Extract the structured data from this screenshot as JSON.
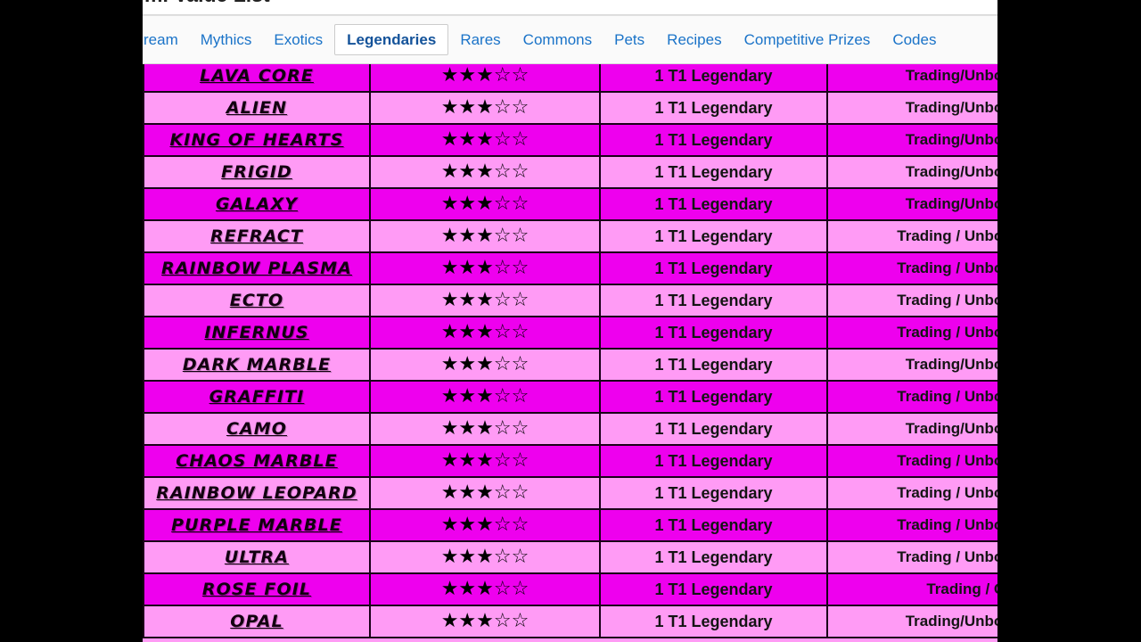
{
  "document": {
    "title": "m. Value List"
  },
  "tabs": [
    {
      "label": "ream",
      "active": false
    },
    {
      "label": "Mythics",
      "active": false
    },
    {
      "label": "Exotics",
      "active": false
    },
    {
      "label": "Legendaries",
      "active": true
    },
    {
      "label": "Rares",
      "active": false
    },
    {
      "label": "Commons",
      "active": false
    },
    {
      "label": "Pets",
      "active": false
    },
    {
      "label": "Recipes",
      "active": false
    },
    {
      "label": "Competitive Prizes",
      "active": false
    },
    {
      "label": "Codes",
      "active": false
    }
  ],
  "colors": {
    "row_dark": "#ee00ee",
    "row_light": "#ff9bf5",
    "grid_line": "#1a0018",
    "tab_link": "#1a73c8",
    "tab_active": "#14539a",
    "letterbox": "#000000"
  },
  "table": {
    "rows": [
      {
        "name": "LAVA CORE",
        "stars": "★★★☆☆",
        "rating": 3,
        "demand": "1 T1 Legendary",
        "obtain": "Trading/Unboxing/Cra",
        "shade": "dark"
      },
      {
        "name": "ALIEN",
        "stars": "★★★☆☆",
        "rating": 3,
        "demand": "1 T1 Legendary",
        "obtain": "Trading/Unboxing/Cra",
        "shade": "light"
      },
      {
        "name": "KING OF HEARTS",
        "stars": "★★★☆☆",
        "rating": 3,
        "demand": "1 T1 Legendary",
        "obtain": "Trading/Unboxing/Cra",
        "shade": "dark"
      },
      {
        "name": "FRIGID",
        "stars": "★★★☆☆",
        "rating": 3,
        "demand": "1 T1 Legendary",
        "obtain": "Trading/Unboxing/Cra",
        "shade": "light"
      },
      {
        "name": "GALAXY",
        "stars": "★★★☆☆",
        "rating": 3,
        "demand": "1 T1 Legendary",
        "obtain": "Trading/Unboxing/Cra",
        "shade": "dark"
      },
      {
        "name": "REFRACT",
        "stars": "★★★☆☆",
        "rating": 3,
        "demand": "1 T1 Legendary",
        "obtain": "Trading / Unboxing / Cra",
        "shade": "light"
      },
      {
        "name": "RAINBOW PLASMA",
        "stars": "★★★☆☆",
        "rating": 3,
        "demand": "1 T1 Legendary",
        "obtain": "Trading / Unboxing / Cra",
        "shade": "dark"
      },
      {
        "name": "ECTO",
        "stars": "★★★☆☆",
        "rating": 3,
        "demand": "1 T1 Legendary",
        "obtain": "Trading / Unboxing / Cra",
        "shade": "light"
      },
      {
        "name": "INFERNUS",
        "stars": "★★★☆☆",
        "rating": 3,
        "demand": "1 T1 Legendary",
        "obtain": "Trading / Unboxing / Cra",
        "shade": "dark"
      },
      {
        "name": "DARK MARBLE",
        "stars": "★★★☆☆",
        "rating": 3,
        "demand": "1 T1 Legendary",
        "obtain": "Trading/Unboxing/Cra",
        "shade": "light"
      },
      {
        "name": "GRAFFITI",
        "stars": "★★★☆☆",
        "rating": 3,
        "demand": "1 T1 Legendary",
        "obtain": "Trading / Unboxing / Cra",
        "shade": "dark"
      },
      {
        "name": "CAMO",
        "stars": "★★★☆☆",
        "rating": 3,
        "demand": "1 T1 Legendary",
        "obtain": "Trading/Unboxing/Cra",
        "shade": "light"
      },
      {
        "name": "CHAOS MARBLE",
        "stars": "★★★☆☆",
        "rating": 3,
        "demand": "1 T1 Legendary",
        "obtain": "Trading / Unboxing / Cra",
        "shade": "dark"
      },
      {
        "name": "RAINBOW LEOPARD",
        "stars": "★★★☆☆",
        "rating": 3,
        "demand": "1 T1 Legendary",
        "obtain": "Trading / Unboxing / Cra",
        "shade": "light"
      },
      {
        "name": "PURPLE MARBLE",
        "stars": "★★★☆☆",
        "rating": 3,
        "demand": "1 T1 Legendary",
        "obtain": "Trading / Unboxing / Cra",
        "shade": "dark"
      },
      {
        "name": "ULTRA",
        "stars": "★★★☆☆",
        "rating": 3,
        "demand": "1 T1 Legendary",
        "obtain": "Trading / Unboxing / Cra",
        "shade": "light"
      },
      {
        "name": "ROSE FOIL",
        "stars": "★★★☆☆",
        "rating": 3,
        "demand": "1 T1 Legendary",
        "obtain": "Trading / Craftin",
        "shade": "dark"
      },
      {
        "name": "OPAL",
        "stars": "★★★☆☆",
        "rating": 3,
        "demand": "1 T1 Legendary",
        "obtain": "Trading/Unboxing/Cra",
        "shade": "light"
      }
    ]
  }
}
